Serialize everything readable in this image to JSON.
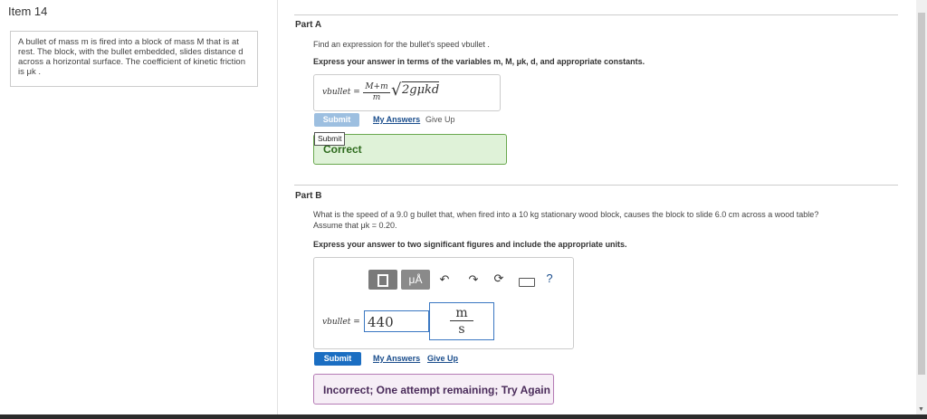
{
  "item": {
    "title": "Item 14"
  },
  "problem": {
    "line1": "A bullet of mass m is fired into a block of mass M that is at",
    "line2": "rest. The block, with the bullet embedded, slides distance d",
    "line3": "across a horizontal surface. The coefficient of kinetic friction",
    "line4": "is μk ."
  },
  "partA": {
    "label": "Part A",
    "prompt": "Find an expression for the bullet's speed vbullet .",
    "instruction": "Express your answer in terms of the variables m, M, μk, d, and appropriate constants.",
    "var_label": "vbullet =",
    "frac_num": "M+m",
    "frac_den": "m",
    "sqrt_content": "2gμkd",
    "submit": "Submit",
    "my_answers": "My Answers",
    "give_up": "Give Up",
    "tooltip": "Submit",
    "feedback": "Correct"
  },
  "partB": {
    "label": "Part B",
    "prompt1": "What is the speed of a 9.0 g bullet that, when fired into a 10 kg stationary wood block, causes the block to slide 6.0 cm across a wood table?",
    "prompt2": "Assume that μk = 0.20.",
    "instruction": "Express your answer to two significant figures and include the appropriate units.",
    "var_label": "vbullet =",
    "value": "440",
    "unit_num": "m",
    "unit_den": "s",
    "submit": "Submit",
    "my_answers": "My Answers",
    "give_up": "Give Up",
    "feedback": "Incorrect; One attempt remaining; Try Again",
    "toolbar": {
      "mu_label": "μÅ",
      "help": "?"
    }
  }
}
